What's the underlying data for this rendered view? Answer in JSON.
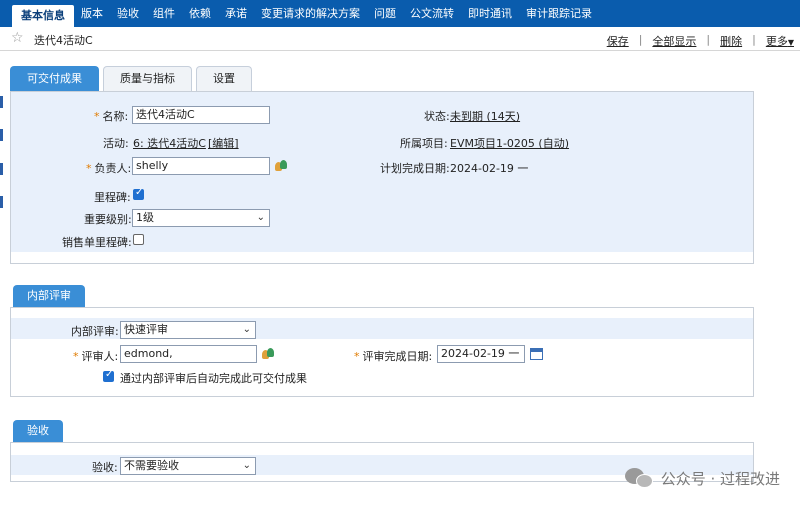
{
  "topnav": {
    "tabs": [
      "基本信息",
      "版本",
      "验收",
      "组件",
      "依赖",
      "承诺",
      "变更请求的解决方案",
      "问题",
      "公文流转",
      "即时通讯",
      "审计跟踪记录"
    ]
  },
  "titlebar": {
    "title": "迭代4活动C",
    "actions": {
      "save": "保存",
      "show_all": "全部显示",
      "delete": "删除",
      "more": "更多"
    }
  },
  "section_tabs": [
    "可交付成果",
    "质量与指标",
    "设置"
  ],
  "deliverable": {
    "name_label": "名称:",
    "name_value": "迭代4活动C",
    "status_label": "状态:",
    "status_value": "未到期 (14天)",
    "activity_label": "活动:",
    "activity_value": "6: 迭代4活动C",
    "edit_link": "[编辑]",
    "project_label": "所属项目:",
    "project_value": "EVM项目1-0205 (自动)",
    "owner_label": "负责人:",
    "owner_value": "shelly",
    "planned_date_label": "计划完成日期:",
    "planned_date_value": "2024-02-19 一",
    "milestone_label": "里程碑:",
    "milestone_checked": true,
    "importance_label": "重要级别:",
    "importance_value": "1级",
    "sales_milestone_label": "销售单里程碑:",
    "sales_milestone_checked": false
  },
  "internal_review": {
    "tab": "内部评审",
    "review_label": "内部评审:",
    "review_value": "快速评审",
    "reviewer_label": "评审人:",
    "reviewer_value": "edmond,",
    "review_date_label": "评审完成日期:",
    "review_date_value": "2024-02-19 一",
    "auto_complete_label": "通过内部评审后自动完成此可交付成果",
    "auto_complete_checked": true
  },
  "acceptance": {
    "tab": "验收",
    "label": "验收:",
    "value": "不需要验收"
  },
  "watermark": {
    "text": "公众号 · 过程改进"
  },
  "colors": {
    "nav": "#0a5cad",
    "accent": "#3a8ed6",
    "panel_bg": "#e8f0fb",
    "required": "#e07b00"
  }
}
